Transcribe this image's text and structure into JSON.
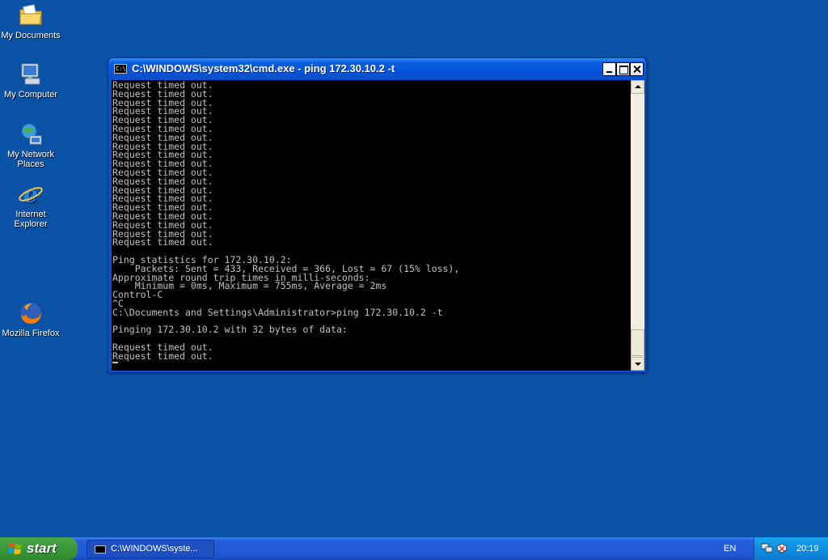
{
  "desktop": {
    "icons": [
      {
        "label": "My Documents",
        "icon": "folder-documents-icon"
      },
      {
        "label": "My Computer",
        "icon": "computer-icon"
      },
      {
        "label": "My Network Places",
        "icon": "network-icon"
      },
      {
        "label": "Internet Explorer",
        "icon": "internet-explorer-icon"
      },
      {
        "label": "Mozilla Firefox",
        "icon": "firefox-icon"
      }
    ],
    "background_color": "#0a52a6"
  },
  "window": {
    "title": "C:\\WINDOWS\\system32\\cmd.exe - ping 172.30.10.2 -t",
    "icon_glyph": "C:\\",
    "console_lines": [
      "Request timed out.",
      "Request timed out.",
      "Request timed out.",
      "Request timed out.",
      "Request timed out.",
      "Request timed out.",
      "Request timed out.",
      "Request timed out.",
      "Request timed out.",
      "Request timed out.",
      "Request timed out.",
      "Request timed out.",
      "Request timed out.",
      "Request timed out.",
      "Request timed out.",
      "Request timed out.",
      "Request timed out.",
      "Request timed out.",
      "Request timed out.",
      "",
      "Ping statistics for 172.30.10.2:",
      "    Packets: Sent = 433, Received = 366, Lost = 67 (15% loss),",
      "Approximate round trip times in milli-seconds:",
      "    Minimum = 0ms, Maximum = 755ms, Average = 2ms",
      "Control-C",
      "^C",
      "C:\\Documents and Settings\\Administrator>ping 172.30.10.2 -t",
      "",
      "Pinging 172.30.10.2 with 32 bytes of data:",
      "",
      "Request timed out.",
      "Request timed out."
    ]
  },
  "taskbar": {
    "start_label": "start",
    "task_label": "C:\\WINDOWS\\syste...",
    "language": "EN",
    "clock": "20:19"
  }
}
